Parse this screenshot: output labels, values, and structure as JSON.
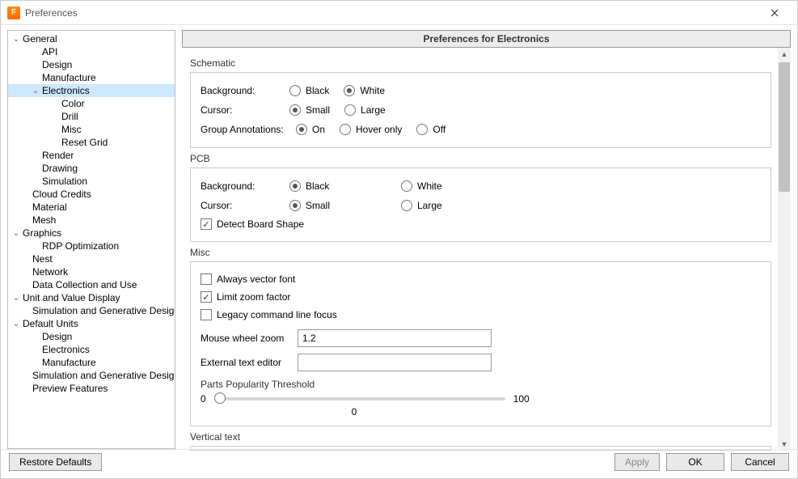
{
  "window": {
    "title": "Preferences"
  },
  "tree": [
    {
      "label": "General",
      "caret": true,
      "indent": 0
    },
    {
      "label": "API",
      "caret": false,
      "indent": 2
    },
    {
      "label": "Design",
      "caret": false,
      "indent": 2
    },
    {
      "label": "Manufacture",
      "caret": false,
      "indent": 2
    },
    {
      "label": "Electronics",
      "caret": true,
      "indent": 2,
      "selected": true
    },
    {
      "label": "Color",
      "caret": false,
      "indent": 4
    },
    {
      "label": "Drill",
      "caret": false,
      "indent": 4
    },
    {
      "label": "Misc",
      "caret": false,
      "indent": 4
    },
    {
      "label": "Reset Grid",
      "caret": false,
      "indent": 4
    },
    {
      "label": "Render",
      "caret": false,
      "indent": 2
    },
    {
      "label": "Drawing",
      "caret": false,
      "indent": 2
    },
    {
      "label": "Simulation",
      "caret": false,
      "indent": 2
    },
    {
      "label": "Cloud Credits",
      "caret": false,
      "indent": 1
    },
    {
      "label": "Material",
      "caret": false,
      "indent": 1
    },
    {
      "label": "Mesh",
      "caret": false,
      "indent": 1
    },
    {
      "label": "Graphics",
      "caret": true,
      "indent": 0
    },
    {
      "label": "RDP Optimization",
      "caret": false,
      "indent": 2
    },
    {
      "label": "Nest",
      "caret": false,
      "indent": 1
    },
    {
      "label": "Network",
      "caret": false,
      "indent": 1
    },
    {
      "label": "Data Collection and Use",
      "caret": false,
      "indent": 1
    },
    {
      "label": "Unit and Value Display",
      "caret": true,
      "indent": 0
    },
    {
      "label": "Simulation and Generative Design",
      "caret": false,
      "indent": 2
    },
    {
      "label": "Default Units",
      "caret": true,
      "indent": 0
    },
    {
      "label": "Design",
      "caret": false,
      "indent": 2
    },
    {
      "label": "Electronics",
      "caret": false,
      "indent": 2
    },
    {
      "label": "Manufacture",
      "caret": false,
      "indent": 2
    },
    {
      "label": "Simulation and Generative Design",
      "caret": false,
      "indent": 2
    },
    {
      "label": "Preview Features",
      "caret": false,
      "indent": 1
    }
  ],
  "header": "Preferences for Electronics",
  "schematic": {
    "title": "Schematic",
    "backgroundLabel": "Background:",
    "cursorLabel": "Cursor:",
    "groupAnnLabel": "Group Annotations:",
    "opts": {
      "black": "Black",
      "white": "White",
      "small": "Small",
      "large": "Large",
      "on": "On",
      "hover": "Hover only",
      "off": "Off"
    },
    "background": "White",
    "cursor": "Small",
    "groupAnn": "On"
  },
  "pcb": {
    "title": "PCB",
    "backgroundLabel": "Background:",
    "cursorLabel": "Cursor:",
    "opts": {
      "black": "Black",
      "white": "White",
      "small": "Small",
      "large": "Large"
    },
    "background": "Black",
    "cursor": "Small",
    "detectBoard": {
      "label": "Detect Board Shape",
      "checked": true
    }
  },
  "misc": {
    "title": "Misc",
    "alwaysVector": {
      "label": "Always vector font",
      "checked": false
    },
    "limitZoom": {
      "label": "Limit zoom factor",
      "checked": true
    },
    "legacyCmd": {
      "label": "Legacy command line focus",
      "checked": false
    },
    "mouseWheelLabel": "Mouse wheel zoom",
    "mouseWheelValue": "1.2",
    "externalEditorLabel": "External text editor",
    "externalEditorValue": "",
    "partsPopLabel": "Parts Popularity Threshold",
    "sliderMin": "0",
    "sliderMax": "100",
    "sliderValue": "0"
  },
  "vertical": {
    "title": "Vertical text"
  },
  "footer": {
    "restore": "Restore Defaults",
    "apply": "Apply",
    "ok": "OK",
    "cancel": "Cancel"
  }
}
